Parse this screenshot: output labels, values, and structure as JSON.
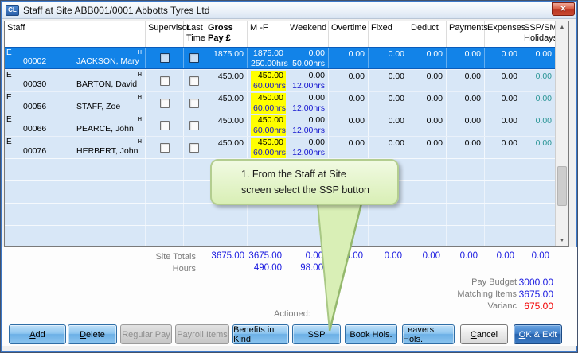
{
  "window": {
    "title": "Staff at Site ABB001/0001 Abbotts Tyres Ltd",
    "icon_text": "CL",
    "close_label": "✕"
  },
  "table": {
    "columns": [
      {
        "key": "staff",
        "label": "Staff"
      },
      {
        "key": "supervisor",
        "label": "Supervisor"
      },
      {
        "key": "last_time",
        "label": "Last\nTime"
      },
      {
        "key": "gross",
        "label": "Gross\nPay £",
        "bold": true
      },
      {
        "key": "mf",
        "label": "M -F"
      },
      {
        "key": "weekend",
        "label": "Weekend"
      },
      {
        "key": "overtime",
        "label": "Overtime"
      },
      {
        "key": "fixed",
        "label": "Fixed"
      },
      {
        "key": "deduct",
        "label": "Deduct"
      },
      {
        "key": "payments",
        "label": "Payments"
      },
      {
        "key": "expenses",
        "label": "Expenses"
      },
      {
        "key": "ssp",
        "label": "SSP/SMP\nHolidays"
      }
    ],
    "rows": [
      {
        "prefix": "E",
        "marker": "H",
        "number": "00002",
        "name": "JACKSON, Mary",
        "supervisor_checked": false,
        "last_time_checked": false,
        "gross": "1875.00",
        "mf_value": "1875.00",
        "mf_hours": "250.00hrs",
        "weekend_value": "0.00",
        "weekend_hours": "50.00hrs",
        "overtime": "0.00",
        "fixed": "0.00",
        "deduct": "0.00",
        "payments": "0.00",
        "expenses": "0.00",
        "ssp": "0.00",
        "selected": true
      },
      {
        "prefix": "E",
        "marker": "H",
        "number": "00030",
        "name": "BARTON, David",
        "supervisor_checked": false,
        "last_time_checked": false,
        "gross": "450.00",
        "mf_value": "450.00",
        "mf_hours": "60.00hrs",
        "weekend_value": "0.00",
        "weekend_hours": "12.00hrs",
        "overtime": "0.00",
        "fixed": "0.00",
        "deduct": "0.00",
        "payments": "0.00",
        "expenses": "0.00",
        "ssp": "0.00",
        "selected": false
      },
      {
        "prefix": "E",
        "marker": "H",
        "number": "00056",
        "name": "STAFF, Zoe",
        "supervisor_checked": false,
        "last_time_checked": false,
        "gross": "450.00",
        "mf_value": "450.00",
        "mf_hours": "60.00hrs",
        "weekend_value": "0.00",
        "weekend_hours": "12.00hrs",
        "overtime": "0.00",
        "fixed": "0.00",
        "deduct": "0.00",
        "payments": "0.00",
        "expenses": "0.00",
        "ssp": "0.00",
        "selected": false
      },
      {
        "prefix": "E",
        "marker": "H",
        "number": "00066",
        "name": "PEARCE, John",
        "supervisor_checked": false,
        "last_time_checked": false,
        "gross": "450.00",
        "mf_value": "450.00",
        "mf_hours": "60.00hrs",
        "weekend_value": "0.00",
        "weekend_hours": "12.00hrs",
        "overtime": "0.00",
        "fixed": "0.00",
        "deduct": "0.00",
        "payments": "0.00",
        "expenses": "0.00",
        "ssp": "0.00",
        "selected": false
      },
      {
        "prefix": "E",
        "marker": "H",
        "number": "00076",
        "name": "HERBERT, John",
        "supervisor_checked": false,
        "last_time_checked": false,
        "gross": "450.00",
        "mf_value": "450.00",
        "mf_hours": "60.00hrs",
        "weekend_value": "0.00",
        "weekend_hours": "12.00hrs",
        "overtime": "0.00",
        "fixed": "0.00",
        "deduct": "0.00",
        "payments": "0.00",
        "expenses": "0.00",
        "ssp": "0.00",
        "selected": false
      }
    ]
  },
  "totals": {
    "site_totals_label": "Site Totals",
    "site_totals": {
      "gross": "3675.00",
      "mf": "3675.00",
      "weekend": "0.00",
      "overtime": "0.00",
      "fixed": "0.00",
      "deduct": "0.00",
      "payments": "0.00",
      "expenses": "0.00",
      "ssp": "0.00"
    },
    "hours_label": "Hours",
    "hours": {
      "mf": "490.00",
      "weekend": "98.00"
    }
  },
  "summary": {
    "pay_budget_label": "Pay Budget",
    "pay_budget": "3000.00",
    "matching_items_label": "Matching Items",
    "matching_items": "3675.00",
    "variance_label": "Varianc",
    "variance": "675.00",
    "actioned_label": "Actioned:"
  },
  "buttons": [
    {
      "label": "Add",
      "underline": "A",
      "style": "blue"
    },
    {
      "label": "Delete",
      "underline": "D",
      "style": "blue"
    },
    {
      "label": "Regular Pay",
      "style": "disabled"
    },
    {
      "label": "Payroll Items",
      "style": "disabled"
    },
    {
      "label": "Benefits in Kind",
      "style": "blue"
    },
    {
      "label": "SSP",
      "style": "blue"
    },
    {
      "label": "Book Hols.",
      "style": "blue"
    },
    {
      "label": "Leavers Hols.",
      "style": "blue"
    },
    {
      "label": "Cancel",
      "underline": "C",
      "style": "gray"
    },
    {
      "label": "OK & Exit",
      "underline": "O",
      "style": "primary"
    }
  ],
  "callout": {
    "lines": [
      "1. From the Staff at Site",
      "screen select the SSP button"
    ]
  },
  "scrollbar": {
    "up_glyph": "▲",
    "down_glyph": "▼"
  },
  "colors": {
    "selected_row": "#1283e8",
    "row_bg": "#d8e7f7",
    "highlight_yellow": "#ffff00",
    "hours_blue": "#1515cf",
    "ssp_teal": "#2a9596",
    "totals_blue": "#1a1ae0",
    "variance_red": "#f20000"
  }
}
